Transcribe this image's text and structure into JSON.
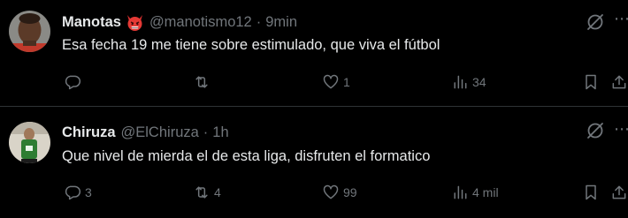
{
  "tweets": [
    {
      "name": "Manotas",
      "badge": "devil-emoji",
      "handle": "@manotismo12",
      "separator": "·",
      "time": "9min",
      "text": "Esa fecha 19 me tiene sobre estimulado, que viva el fútbol",
      "reply_count": "",
      "repost_count": "",
      "like_count": "1",
      "view_count": "34"
    },
    {
      "name": "Chiruza",
      "handle": "@ElChiruza",
      "separator": "·",
      "time": "1h",
      "text": "Que nivel de mierda el de esta liga, disfruten el formatico",
      "reply_count": "3",
      "repost_count": "4",
      "like_count": "99",
      "view_count": "4 mil"
    }
  ],
  "colors": {
    "background": "#000000",
    "text_primary": "#e7e9ea",
    "text_secondary": "#71767b",
    "divider": "#2f3336"
  }
}
